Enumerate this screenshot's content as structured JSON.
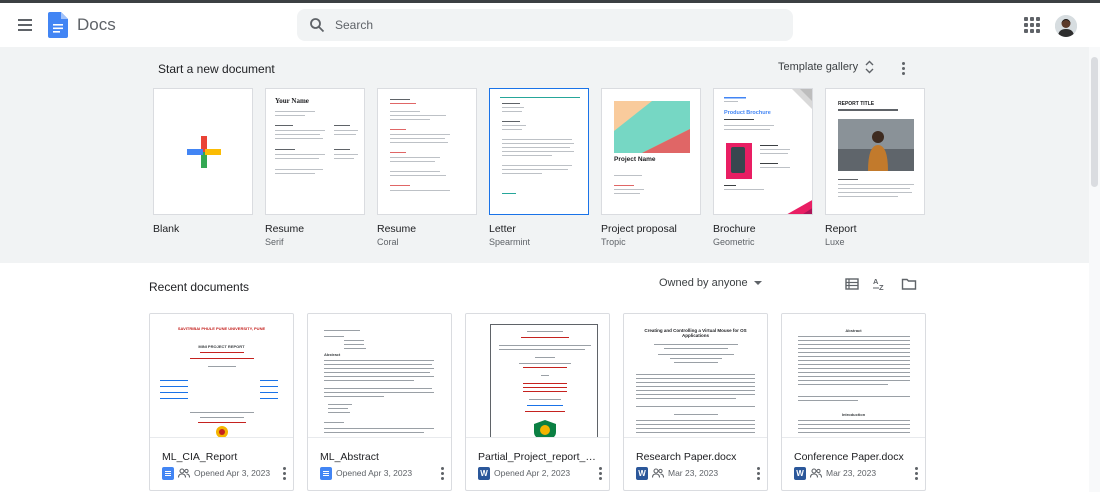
{
  "app": {
    "title": "Docs",
    "menu_icon": "hamburger-menu-icon",
    "logo_icon": "google-docs-logo"
  },
  "search": {
    "placeholder": "Search",
    "icon": "search-icon"
  },
  "header": {
    "apps_icon": "apps-grid-icon",
    "avatar_icon": "account-avatar"
  },
  "templates": {
    "title": "Start a new document",
    "gallery_label": "Template gallery",
    "items": [
      {
        "name": "Blank",
        "sub": ""
      },
      {
        "name": "Resume",
        "sub": "Serif",
        "heading": "Your Name"
      },
      {
        "name": "Resume",
        "sub": "Coral"
      },
      {
        "name": "Letter",
        "sub": "Spearmint"
      },
      {
        "name": "Project proposal",
        "sub": "Tropic",
        "heading": "Project Name"
      },
      {
        "name": "Brochure",
        "sub": "Geometric",
        "heading": "Product Brochure"
      },
      {
        "name": "Report",
        "sub": "Luxe",
        "heading": "REPORT TITLE"
      }
    ]
  },
  "recent": {
    "title": "Recent documents",
    "owner_filter": "Owned by anyone",
    "tools": {
      "list_view": "list-view-icon",
      "sort": "sort-az-icon",
      "folder": "folder-icon"
    },
    "docs": [
      {
        "name": "ML_CIA_Report",
        "opened": "Opened Apr 3, 2023",
        "type": "gdoc",
        "shared": true,
        "preview_title": "SAVITRIBAI PHULE PUNE UNIVERSITY, PUNE",
        "preview_sub": "MINI PROJECT REPORT"
      },
      {
        "name": "ML_Abstract",
        "opened": "Opened Apr 3, 2023",
        "type": "gdoc",
        "shared": false,
        "preview_title": "Abstract",
        "preview_sub": ""
      },
      {
        "name": "Partial_Project_report_S...",
        "opened": "Opened Apr 2, 2023",
        "type": "word",
        "shared": false,
        "preview_title": "",
        "preview_sub": ""
      },
      {
        "name": "Research Paper.docx",
        "opened": "Mar 23, 2023",
        "type": "word",
        "shared": true,
        "preview_title": "Creating and Controlling a Virtual Mouse for OS Applications",
        "preview_sub": ""
      },
      {
        "name": "Conference Paper.docx",
        "opened": "Mar 23, 2023",
        "type": "word",
        "shared": true,
        "preview_title": "Abstract",
        "preview_sub": "Introduction"
      }
    ]
  },
  "colors": {
    "accent": "#1a73e8",
    "band": "#f1f3f4",
    "text": "#202124",
    "muted": "#5f6368"
  }
}
